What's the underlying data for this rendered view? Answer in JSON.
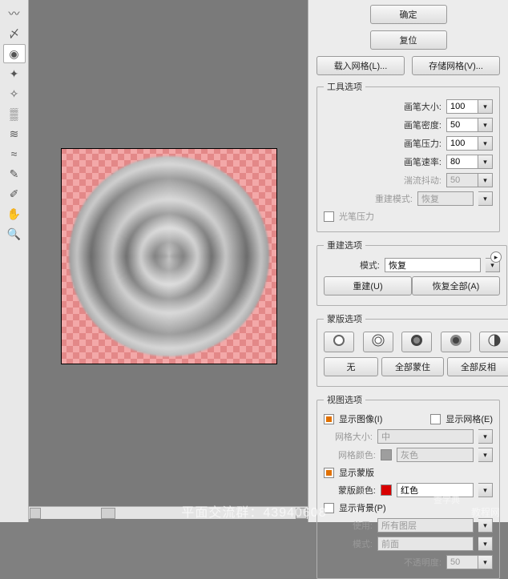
{
  "btn_ok": "确定",
  "btn_reset": "复位",
  "btn_loadgrid": "载入网格(L)...",
  "btn_savegrid": "存储网格(V)...",
  "sect_tool": "工具选项",
  "tool": {
    "brush_size_label": "画笔大小:",
    "brush_size": "100",
    "brush_density_label": "画笔密度:",
    "brush_density": "50",
    "brush_pressure_label": "画笔压力:",
    "brush_pressure": "100",
    "brush_rate_label": "画笔速率:",
    "brush_rate": "80",
    "turb_jitter_label": "湍流抖动:",
    "turb_jitter": "50",
    "rebuild_mode_label": "重建模式:",
    "rebuild_mode_value": "恢复",
    "stylus_label": "光笔压力"
  },
  "sect_rebuild": "重建选项",
  "rebuild": {
    "mode_label": "模式:",
    "mode_value": "恢复",
    "btn_rebuild": "重建(U)",
    "btn_restoreall": "恢复全部(A)"
  },
  "sect_mask": "蒙版选项",
  "mask": {
    "btn_none": "无",
    "btn_maskall": "全部蒙住",
    "btn_invertall": "全部反相"
  },
  "sect_view": "视图选项",
  "view": {
    "show_image_label": "显示图像(I)",
    "show_grid_label": "显示网格(E)",
    "grid_size_label": "网格大小:",
    "grid_size_value": "中",
    "grid_color_label": "网格颜色:",
    "grid_color_value": "灰色",
    "show_mask_label": "显示蒙版",
    "mask_color_label": "蒙版颜色:",
    "mask_color_value": "红色",
    "show_bg_label": "显示背景(P)",
    "use_label": "使用:",
    "use_value": "所有图层",
    "mode_label": "模式:",
    "mode_value": "前面",
    "opacity_label": "不透明度:",
    "opacity_value": "50"
  },
  "footer": "平面交流群：43940608",
  "wm_a": "查字典",
  "wm_b": "教程网"
}
